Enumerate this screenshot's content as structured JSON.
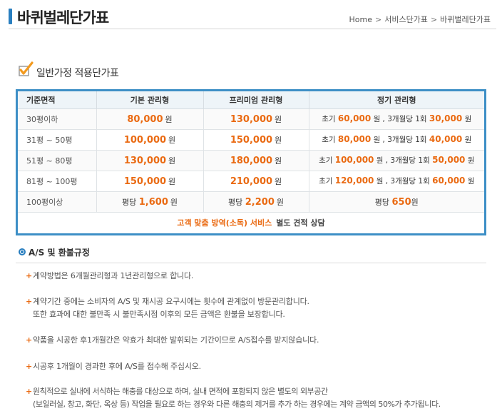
{
  "header": {
    "title": "바퀴벌레단가표",
    "breadcrumb": [
      "Home",
      "서비스단가표",
      "바퀴벌레단가표"
    ],
    "separator": ">"
  },
  "section": {
    "title": "일반가정 적용단가표"
  },
  "table": {
    "headers": [
      "기준면적",
      "기본 관리형",
      "프리미엄 관리형",
      "정기 관리형"
    ],
    "unit": "원",
    "rows": [
      {
        "area": "30평이하",
        "basic": "80,000",
        "premium": "130,000",
        "p_initial": "60,000",
        "p_period": "30,000"
      },
      {
        "area": "31평 ~ 50평",
        "basic": "100,000",
        "premium": "150,000",
        "p_initial": "80,000",
        "p_period": "40,000"
      },
      {
        "area": "51평 ~ 80평",
        "basic": "130,000",
        "premium": "180,000",
        "p_initial": "100,000",
        "p_period": "50,000"
      },
      {
        "area": "81평 ~ 100평",
        "basic": "150,000",
        "premium": "210,000",
        "p_initial": "120,000",
        "p_period": "60,000"
      }
    ],
    "periodic_labels": {
      "initial": "초기",
      "mid": "원 , 3개월당 1회",
      "end": "원"
    },
    "last_row": {
      "area": "100평이상",
      "prefix": "평당",
      "basic": "1,600",
      "premium": "2,200",
      "periodic": "650",
      "unit_end": "원"
    },
    "footer": {
      "highlight": "고객 맞춤 방역(소독) 서비스",
      "rest": "별도 견적 상담"
    }
  },
  "as_section": {
    "title": "A/S 및 환불규정",
    "bullet": "+",
    "items": [
      {
        "lines": [
          "계약방법은 6개월관리형과 1년관리형으로 합니다."
        ]
      },
      {
        "lines": [
          "계약기간 중에는 소비자의 A/S 및 재시공 요구시에는 횟수에 관계없이 방문관리합니다.",
          "또한 효과에 대한 불만족 시 불만족시점 이후의 모든 금액은 환불을 보장합니다."
        ]
      },
      {
        "lines": [
          "약품을 시공한 후1개월간은 약효가 최대한 발휘되는 기간이므로 A/S접수를 받지않습니다."
        ]
      },
      {
        "lines": [
          "시공후 1개월이 경과한 후에 A/S를 접수해 주십시오."
        ]
      },
      {
        "lines": [
          "원칙적으로 실내에 서식하는 해충를 대상으로 하며, 실내 면적에 포함되지 않은 별도의 외부공간",
          "(보일러실, 창고, 화단, 옥상 등) 작업을 필요로 하는 경우와 다른 해충의 제거를 추가 하는 경우에는 계약 금액의  50%가 추가됩니다."
        ]
      }
    ]
  },
  "colors": {
    "accent": "#2a7fc0",
    "orange": "#ea6a12",
    "border": "#3d8fc6"
  }
}
